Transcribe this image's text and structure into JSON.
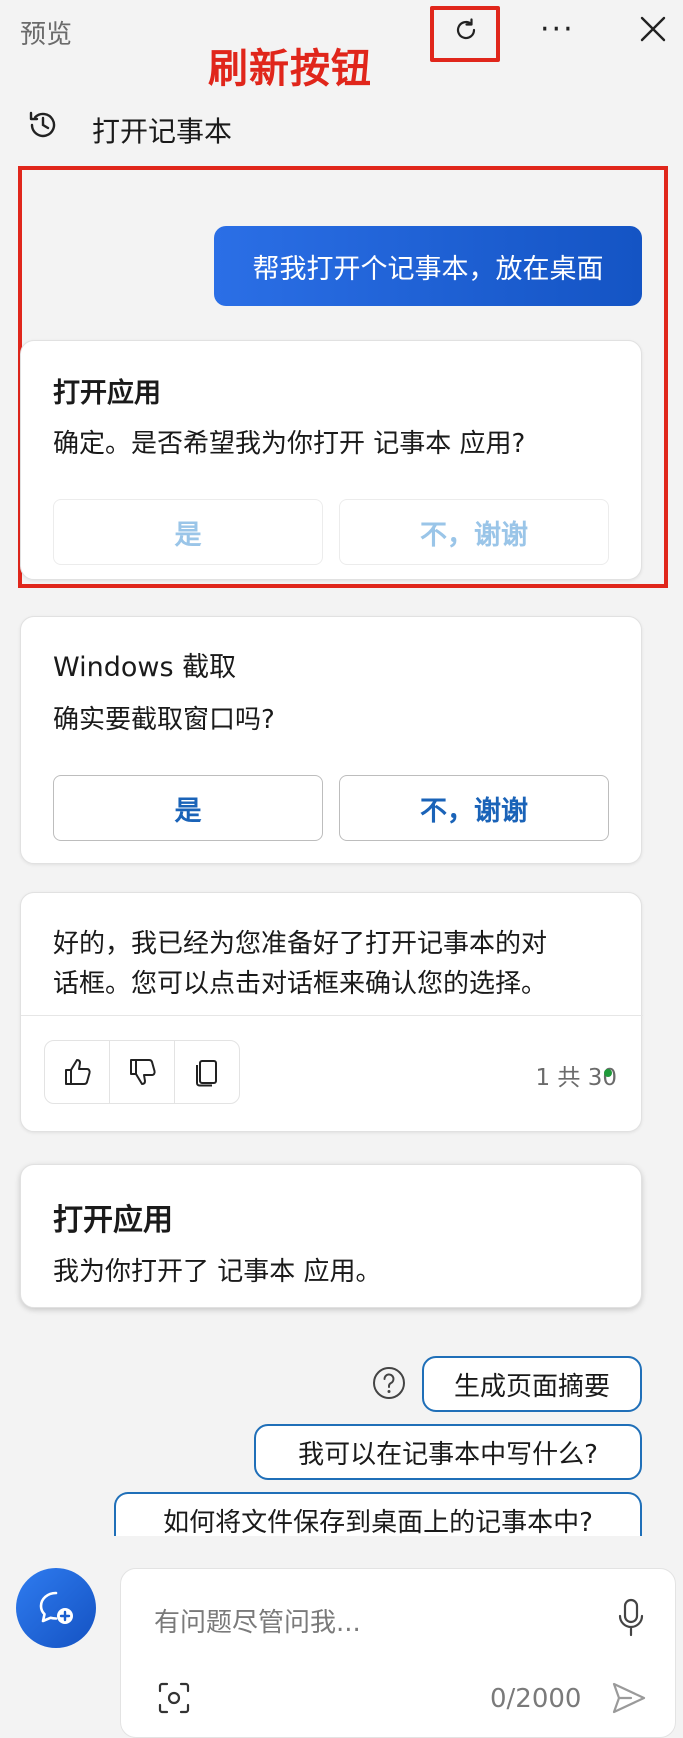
{
  "header": {
    "title": "预览",
    "annotation_label": "刷新按钮",
    "more_label": "···"
  },
  "history": {
    "label": "打开记事本"
  },
  "user_message": "帮我打开个记事本，放在桌面",
  "open_app_card": {
    "title": "打开应用",
    "body": "确定。是否希望我为你打开 记事本 应用?",
    "yes_label": "是",
    "no_label": "不，谢谢"
  },
  "screenshot_card": {
    "title": "Windows 截取",
    "body": "确实要截取窗口吗?",
    "yes_label": "是",
    "no_label": "不，谢谢"
  },
  "assistant_reply": {
    "text_line1": "好的，我已经为您准备好了打开记事本的对",
    "text_line2": "话框。您可以点击对话框来确认您的选择。",
    "counter": "1 共 30"
  },
  "result_card": {
    "title": "打开应用",
    "body": "我为你打开了 记事本 应用。"
  },
  "suggestions": [
    "生成页面摘要",
    "我可以在记事本中写什么?",
    "如何将文件保存到桌面上的记事本中?"
  ],
  "composer": {
    "placeholder": "有问题尽管问我...",
    "char_count": "0/2000"
  },
  "colors": {
    "accent": "#1a63b8",
    "annotation": "#e0261b",
    "user_bubble": "#2b6fe6"
  }
}
